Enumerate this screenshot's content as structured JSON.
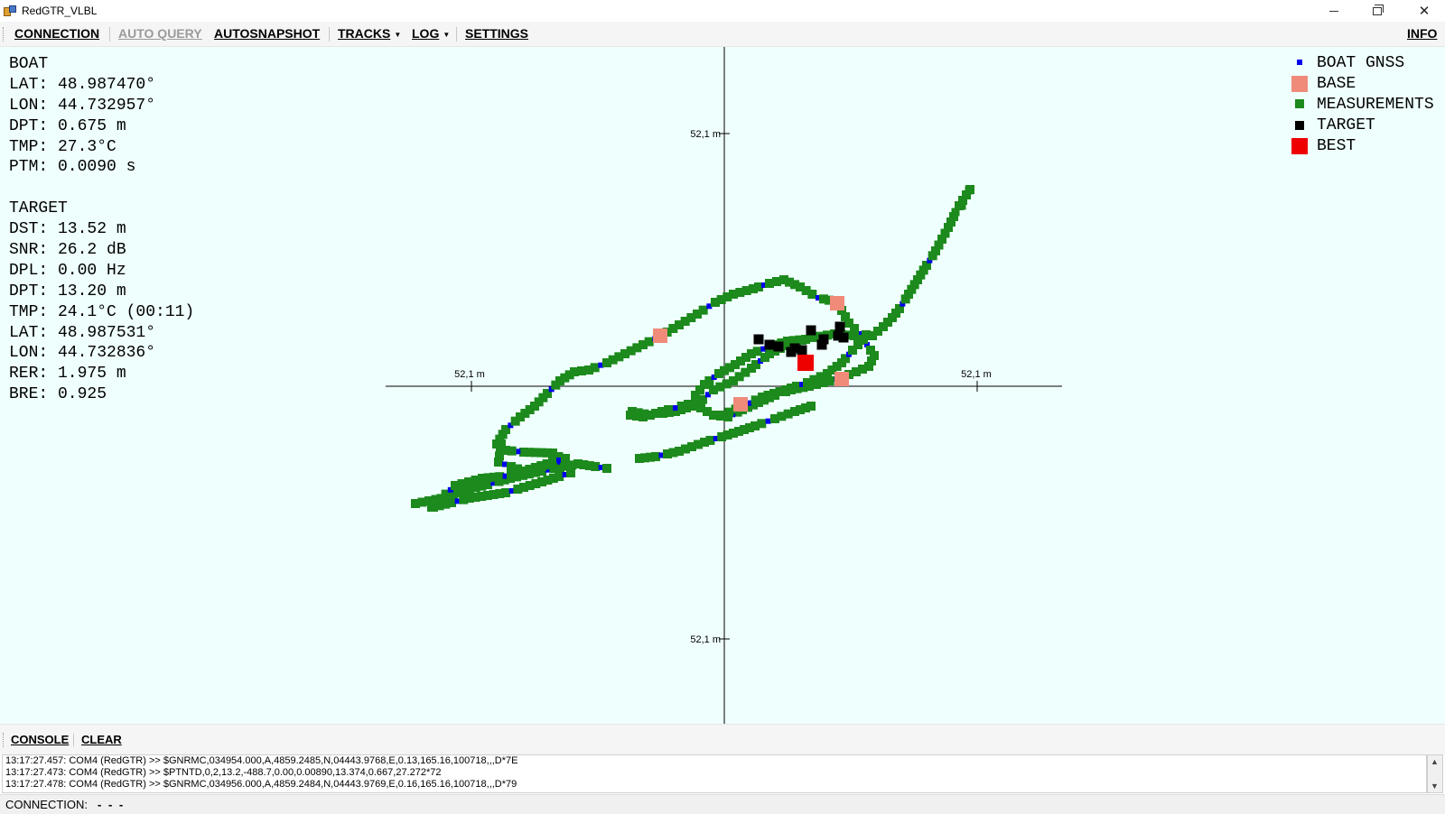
{
  "window": {
    "title": "RedGTR_VLBL",
    "controls": [
      "minimize",
      "restore",
      "close"
    ]
  },
  "menu": {
    "connection": "CONNECTION",
    "auto_query": "AUTO QUERY",
    "autosnapshot": "AUTOSNAPSHOT",
    "tracks": "TRACKS",
    "log": "LOG",
    "settings": "SETTINGS",
    "info": "INFO"
  },
  "boat": {
    "header": "BOAT",
    "lat": "LAT: 48.987470°",
    "lon": "LON: 44.732957°",
    "dpt": "DPT: 0.675 m",
    "tmp": "TMP: 27.3°C",
    "ptm": "PTM: 0.0090 s"
  },
  "target": {
    "header": "TARGET",
    "dst": "DST: 13.52 m",
    "snr": "SNR: 26.2 dB",
    "dpl": "DPL: 0.00 Hz",
    "dpt": "DPT: 13.20 m",
    "tmp": "TMP: 24.1°C (00:11)",
    "lat": "LAT: 48.987531°",
    "lon": "LON: 44.732836°",
    "rer": "RER: 1.975 m",
    "bre": "BRE: 0.925"
  },
  "axes": {
    "top_label": "52,1 m",
    "bottom_label": "52,1 m",
    "left_label": "52,1 m",
    "right_label": "52,1 m"
  },
  "legend": {
    "boat_gnss": "BOAT GNSS",
    "base": "BASE",
    "measurements": "MEASUREMENTS",
    "target": "TARGET",
    "best": "BEST"
  },
  "colors": {
    "boat_gnss": "#0000ee",
    "base": "#f08b7a",
    "measurements": "#1c8a1c",
    "target": "#000000",
    "best": "#ee0000",
    "plot_bg": "#effffe"
  },
  "console": {
    "label": "CONSOLE",
    "clear": "CLEAR",
    "lines": [
      "13:17:27.457: COM4 (RedGTR) >> $GNRMC,034954.000,A,4859.2485,N,04443.9768,E,0.13,165.16,100718,,,D*7E",
      "13:17:27.473: COM4 (RedGTR) >> $PTNTD,0,2,13.2,-488.7,0.00,0.00890,13.374,0.667,27.272*72",
      "13:17:27.478: COM4 (RedGTR) >> $GNRMC,034956.000,A,4859.2484,N,04443.9769,E,0.16,165.16,100718,,,D*79"
    ]
  },
  "status": {
    "label": "CONNECTION:",
    "value": "- - -"
  }
}
